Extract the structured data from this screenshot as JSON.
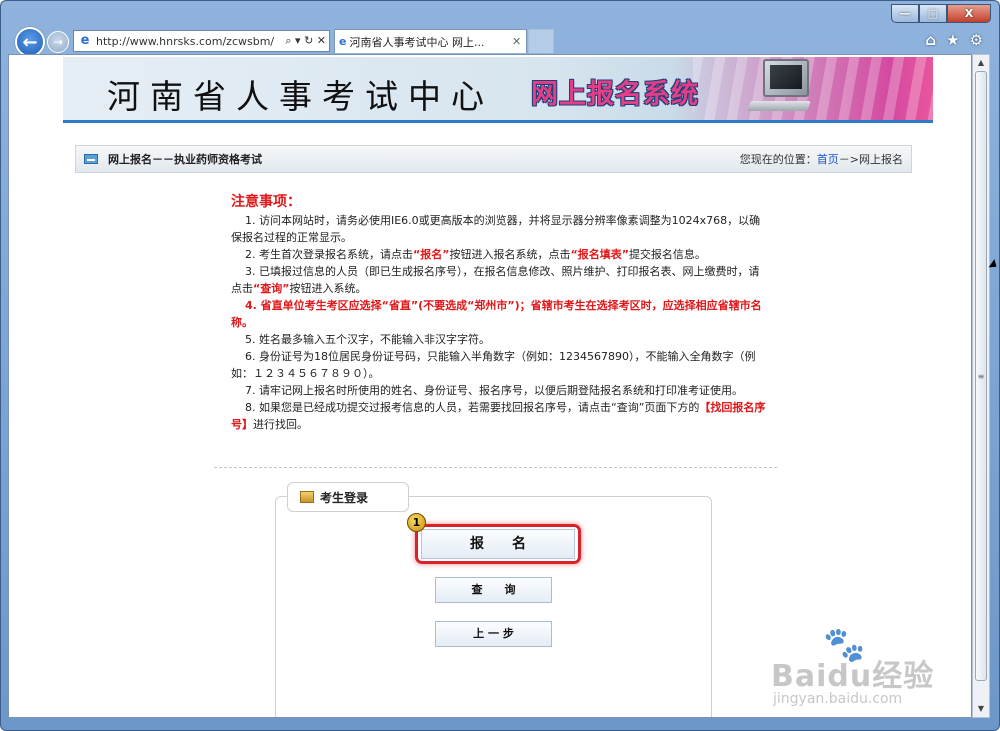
{
  "window": {
    "minimize": "—",
    "maximize": "□",
    "close": "X"
  },
  "browser": {
    "back": "←",
    "forward": "→",
    "address_url": "http://www.hnrsks.com/zcwsbm/",
    "address_tools": "⌕ ▾ ↻ ✕",
    "tab_title": "河南省人事考试中心 网上...",
    "tab_close": "✕",
    "home_icon": "⌂",
    "favorites_icon": "★",
    "tools_icon": "⚙"
  },
  "banner": {
    "title": "河南省人事考试中心",
    "system": "网上报名系统"
  },
  "title_bar": {
    "heading": "网上报名－－执业药师资格考试",
    "location_prefix": "您现在的位置：",
    "location_home": "首页",
    "location_suffix": "－>网上报名"
  },
  "notice": {
    "heading": "注意事项：",
    "item1": "1. 访问本网站时，请务必使用IE6.0或更高版本的浏览器，并将显示器分辨率像素调整为1024x768，以确保报名过程的正常显示。",
    "item2_a": "2. 考生首次登录报名系统，请点击",
    "item2_b": "“报名”",
    "item2_c": "按钮进入报名系统，点击",
    "item2_d": "“报名填表”",
    "item2_e": "提交报名信息。",
    "item3_a": "3. 已填报过信息的人员（即已生成报名序号），在报名信息修改、照片维护、打印报名表、网上缴费时，请点击",
    "item3_b": "“查询”",
    "item3_c": "按钮进入系统。",
    "item4": "4. 省直单位考生考区应选择“省直”(不要选成“郑州市”)；省辖市考生在选择考区时，应选择相应省辖市名称。",
    "item5": "5. 姓名最多输入五个汉字，不能输入非汉字字符。",
    "item6": "6. 身份证号为18位居民身份证号码，只能输入半角数字（例如：1234567890），不能输入全角数字（例如：１２３４５６７８９０）。",
    "item7": "7. 请牢记网上报名时所使用的姓名、身份证号、报名序号，以便后期登陆报名系统和打印准考证使用。",
    "item8_a": "8. 如果您是已经成功提交过报考信息的人员，若需要找回报名序号，请点击“查询”页面下方的",
    "item8_b": "【找回报名序号】",
    "item8_c": "进行找回。"
  },
  "login": {
    "tab_label": "考生登录",
    "badge": "1",
    "register": "报　　名",
    "query": "查　　询",
    "previous": "上 一 步"
  },
  "scrollbar": {
    "up": "▲",
    "grip": "≡",
    "down": "▼"
  },
  "watermark": {
    "paw": "🐾",
    "brand": "Baidu经验",
    "domain": "jingyan.baidu.com"
  },
  "colors": {
    "notice_red": "#e0181a",
    "highlight": "#d8232a",
    "link": "#1a53c7"
  }
}
